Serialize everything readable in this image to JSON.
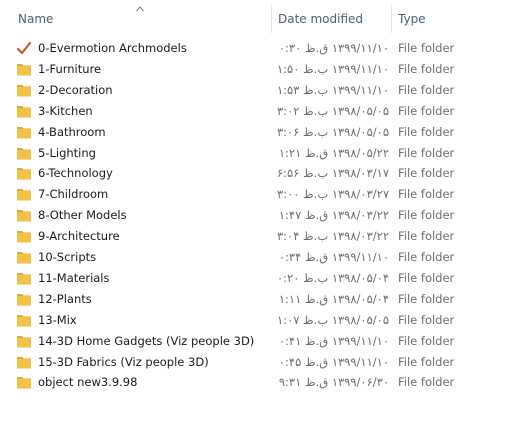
{
  "columns": {
    "name": "Name",
    "date_modified": "Date modified",
    "type": "Type"
  },
  "colors": {
    "folder": "#f0c24a",
    "folder_dark": "#dca83a",
    "checkmark": "#c9582c",
    "header_text": "#4c607a"
  },
  "rows": [
    {
      "name": "0-Evermotion Archmodels",
      "date": "۱۳۹۹/۱۱/۱۰ ق.ظ ۱۰:۳۰",
      "type": "File folder",
      "icon": "checkmark-icon"
    },
    {
      "name": "1-Furniture",
      "date": "۱۳۹۹/۱۱/۱۰ ب.ظ ۱۱:۵۰",
      "type": "File folder",
      "icon": "folder-icon"
    },
    {
      "name": "2-Decoration",
      "date": "۱۳۹۹/۱۱/۱۰ ب.ظ ۱۱:۵۳",
      "type": "File folder",
      "icon": "folder-icon"
    },
    {
      "name": "3-Kitchen",
      "date": "۱۳۹۸/۰۵/۰۵ ب.ظ ۰۳:۰۲",
      "type": "File folder",
      "icon": "folder-icon"
    },
    {
      "name": "4-Bathroom",
      "date": "۱۳۹۸/۰۵/۰۵ ب.ظ ۰۳:۰۶",
      "type": "File folder",
      "icon": "folder-icon"
    },
    {
      "name": "5-Lighting",
      "date": "۱۳۹۸/۰۵/۲۲ ق.ظ ۱۱:۲۱",
      "type": "File folder",
      "icon": "folder-icon"
    },
    {
      "name": "6-Technology",
      "date": "۱۳۹۸/۰۳/۱۷ ب.ظ ۰۶:۵۶",
      "type": "File folder",
      "icon": "folder-icon"
    },
    {
      "name": "7-Childroom",
      "date": "۱۳۹۸/۰۳/۲۷ ب.ظ ۰۳:۰۰",
      "type": "File folder",
      "icon": "folder-icon"
    },
    {
      "name": "8-Other Models",
      "date": "۱۳۹۸/۰۳/۲۲ ق.ظ ۱۱:۴۷",
      "type": "File folder",
      "icon": "folder-icon"
    },
    {
      "name": "9-Architecture",
      "date": "۱۳۹۸/۰۳/۲۲ ب.ظ ۰۳:۰۴",
      "type": "File folder",
      "icon": "folder-icon"
    },
    {
      "name": "10-Scripts",
      "date": "۱۳۹۹/۱۱/۱۰ ق.ظ ۱۰:۳۴",
      "type": "File folder",
      "icon": "folder-icon"
    },
    {
      "name": "11-Materials",
      "date": "۱۳۹۸/۰۵/۰۴ ب.ظ ۱۰:۲۰",
      "type": "File folder",
      "icon": "folder-icon"
    },
    {
      "name": "12-Plants",
      "date": "۱۳۹۸/۰۵/۰۴ ق.ظ ۱۱:۱۱",
      "type": "File folder",
      "icon": "folder-icon"
    },
    {
      "name": "13-Mix",
      "date": "۱۳۹۸/۰۵/۰۵ ب.ظ ۰۱:۰۷",
      "type": "File folder",
      "icon": "folder-icon"
    },
    {
      "name": "14-3D Home Gadgets (Viz people 3D)",
      "date": "۱۳۹۹/۱۱/۱۰ ق.ظ ۱۰:۴۱",
      "type": "File folder",
      "icon": "folder-icon"
    },
    {
      "name": "15-3D Fabrics (Viz people 3D)",
      "date": "۱۳۹۹/۱۱/۱۰ ق.ظ ۱۰:۴۵",
      "type": "File folder",
      "icon": "folder-icon"
    },
    {
      "name": "object new3.9.98",
      "date": "۱۳۹۹/۰۶/۳۰ ق.ظ ۰۹:۳۱",
      "type": "File folder",
      "icon": "folder-icon"
    }
  ]
}
